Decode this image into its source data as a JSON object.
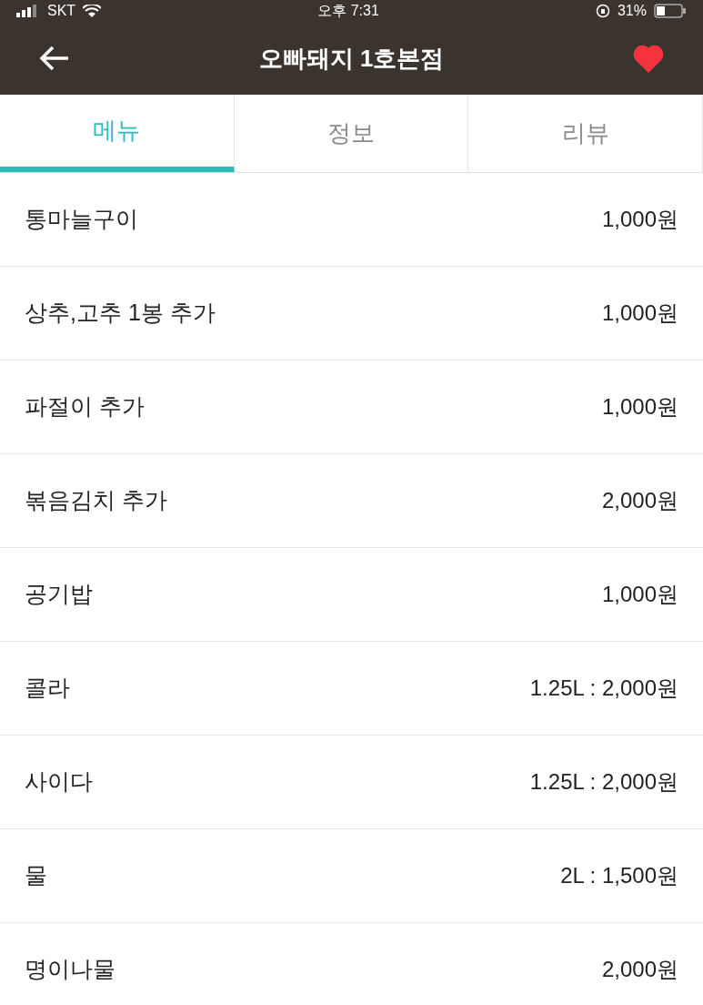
{
  "status_bar": {
    "carrier": "SKT",
    "time": "오후 7:31",
    "battery": "31%"
  },
  "header": {
    "title": "오빠돼지 1호본점",
    "favorite": true
  },
  "tabs": [
    {
      "label": "메뉴",
      "selected": true
    },
    {
      "label": "정보",
      "selected": false
    },
    {
      "label": "리뷰",
      "selected": false
    }
  ],
  "menu_items": [
    {
      "name": "통마늘구이",
      "price": "1,000원"
    },
    {
      "name": "상추,고추 1봉 추가",
      "price": "1,000원"
    },
    {
      "name": "파절이 추가",
      "price": "1,000원"
    },
    {
      "name": "볶음김치 추가",
      "price": "2,000원"
    },
    {
      "name": "공기밥",
      "price": "1,000원"
    },
    {
      "name": "콜라",
      "price": "1.25L : 2,000원"
    },
    {
      "name": "사이다",
      "price": "1.25L : 2,000원"
    },
    {
      "name": "물",
      "price": "2L : 1,500원"
    },
    {
      "name": "명이나물",
      "price": "2,000원"
    }
  ]
}
